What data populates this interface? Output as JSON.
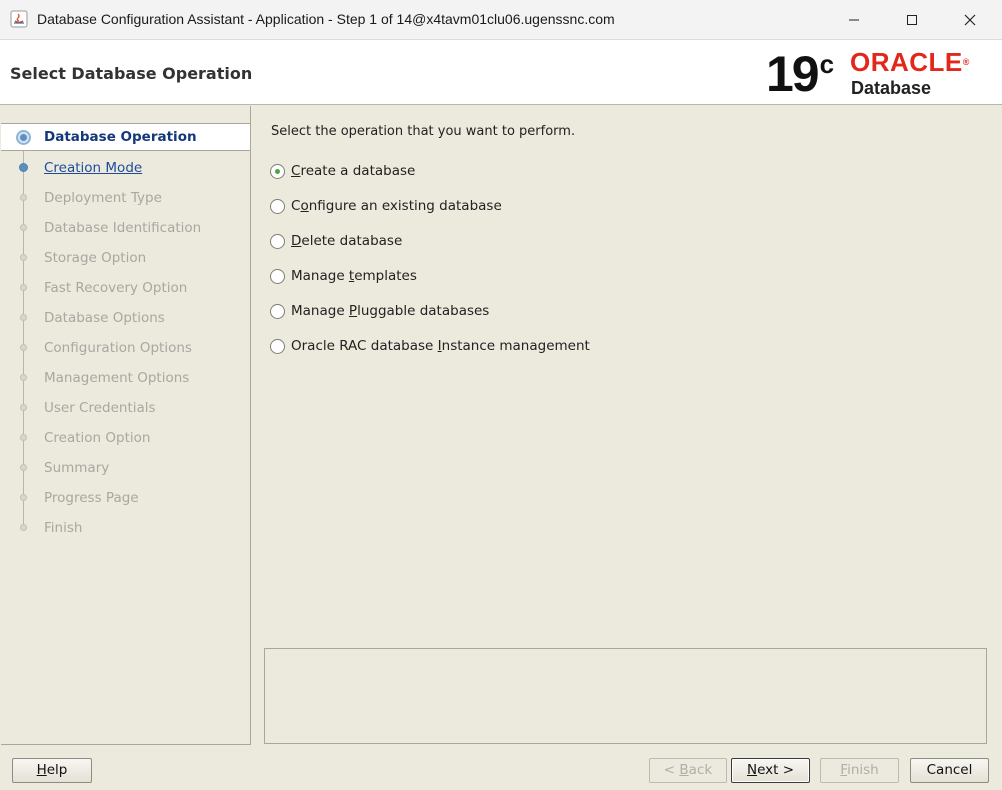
{
  "window": {
    "title": "Database Configuration Assistant - Application - Step 1 of 14@x4tavm01clu06.ugenssnc.com",
    "controls": [
      "minimize-icon",
      "maximize-icon",
      "close-icon"
    ]
  },
  "header": {
    "page_title": "Select Database Operation",
    "brand": {
      "version": "19",
      "version_sup": "c",
      "company": "ORACLE",
      "product": "Database",
      "accent_color": "#e3271b"
    }
  },
  "nav": {
    "items": [
      {
        "label": "Database Operation",
        "state": "active"
      },
      {
        "label": "Creation Mode",
        "state": "link"
      },
      {
        "label": "Deployment Type",
        "state": "disabled"
      },
      {
        "label": "Database Identification",
        "state": "disabled"
      },
      {
        "label": "Storage Option",
        "state": "disabled"
      },
      {
        "label": "Fast Recovery Option",
        "state": "disabled"
      },
      {
        "label": "Database Options",
        "state": "disabled"
      },
      {
        "label": "Configuration Options",
        "state": "disabled"
      },
      {
        "label": "Management Options",
        "state": "disabled"
      },
      {
        "label": "User Credentials",
        "state": "disabled"
      },
      {
        "label": "Creation Option",
        "state": "disabled"
      },
      {
        "label": "Summary",
        "state": "disabled"
      },
      {
        "label": "Progress Page",
        "state": "disabled"
      },
      {
        "label": "Finish",
        "state": "disabled"
      }
    ]
  },
  "main": {
    "prompt": "Select the operation that you want to perform.",
    "options": [
      {
        "pre": "",
        "mnemonic": "C",
        "post": "reate a database",
        "selected": true
      },
      {
        "pre": "C",
        "mnemonic": "o",
        "post": "nfigure an existing database",
        "selected": false
      },
      {
        "pre": "",
        "mnemonic": "D",
        "post": "elete database",
        "selected": false
      },
      {
        "pre": "Manage ",
        "mnemonic": "t",
        "post": "emplates",
        "selected": false
      },
      {
        "pre": "Manage ",
        "mnemonic": "P",
        "post": "luggable databases",
        "selected": false
      },
      {
        "pre": "Oracle RAC database ",
        "mnemonic": "I",
        "post": "nstance management",
        "selected": false
      }
    ]
  },
  "footer": {
    "help": {
      "pre": "",
      "mnemonic": "H",
      "post": "elp"
    },
    "back": {
      "pre": "< ",
      "mnemonic": "B",
      "post": "ack"
    },
    "next": {
      "pre": "",
      "mnemonic": "N",
      "post": "ext >"
    },
    "finish": {
      "pre": "",
      "mnemonic": "F",
      "post": "inish"
    },
    "cancel": {
      "pre": "Cancel",
      "mnemonic": "",
      "post": ""
    }
  }
}
